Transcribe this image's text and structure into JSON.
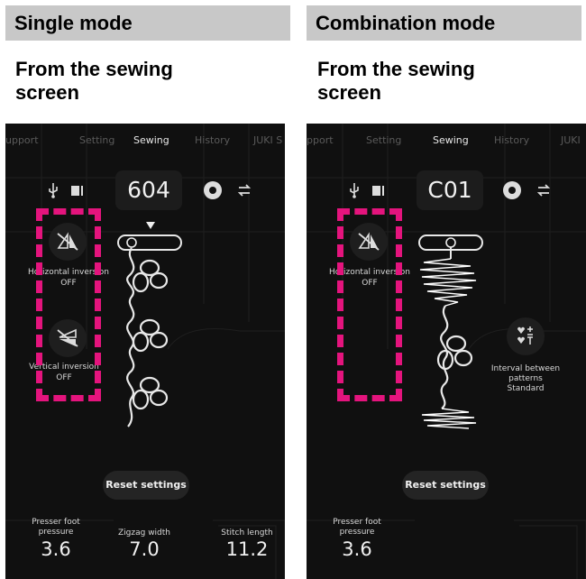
{
  "left": {
    "header": "Single mode",
    "subheader_line1": "From the sewing",
    "subheader_line2": "screen",
    "tabs": [
      "upport",
      "Setting",
      "Sewing",
      "History",
      "JUKI S"
    ],
    "pattern_number": "604",
    "horizontal_inversion": {
      "label": "Horizontal inversion",
      "value": "OFF"
    },
    "vertical_inversion": {
      "label": "Vertical inversion",
      "value": "OFF"
    },
    "reset_label": "Reset settings",
    "params": [
      {
        "label_line1": "Presser foot",
        "label_line2": "pressure",
        "value": "3.6"
      },
      {
        "label_line1": "Zigzag width",
        "label_line2": "",
        "value": "7.0"
      },
      {
        "label_line1": "Stitch length",
        "label_line2": "",
        "value": "11.2"
      }
    ]
  },
  "right": {
    "header": "Combination mode",
    "subheader_line1": "From the sewing",
    "subheader_line2": "screen",
    "tabs": [
      "pport",
      "Setting",
      "Sewing",
      "History",
      "JUKI"
    ],
    "pattern_number": "C01",
    "horizontal_inversion": {
      "label": "Horizontal inversion",
      "value": "OFF"
    },
    "interval": {
      "line1": "Interval between",
      "line2": "patterns",
      "line3": "Standard"
    },
    "reset_label": "Reset settings",
    "params": [
      {
        "label_line1": "Presser foot",
        "label_line2": "pressure",
        "value": "3.6"
      }
    ]
  },
  "colors": {
    "highlight": "#e4147d",
    "phone_bg": "#101010",
    "header_bg": "#c8c8c8"
  },
  "icons": [
    "usb-icon",
    "memory-icon",
    "gear-icon",
    "swap-icon",
    "horizontal-inversion-icon",
    "vertical-inversion-icon",
    "interval-icon"
  ]
}
